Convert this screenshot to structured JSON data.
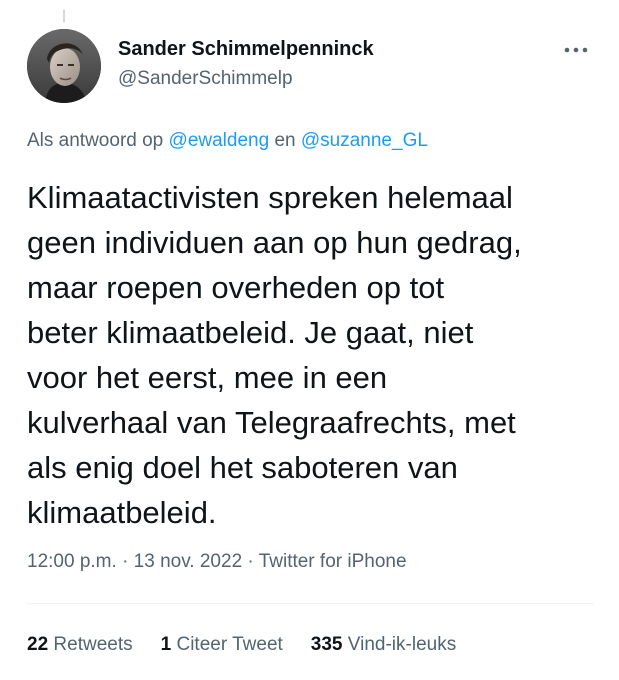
{
  "author": {
    "display_name": "Sander Schimmelpenninck",
    "handle": "@SanderSchimmelp"
  },
  "more_icon": "more-horizontal-icon",
  "reply_context": {
    "prefix": "Als antwoord op",
    "mention_1": "@ewaldeng",
    "joiner": "en",
    "mention_2": "@suzanne_GL"
  },
  "tweet": {
    "lines": [
      "Klimaatactivisten spreken helemaal",
      "geen individuen aan op hun gedrag,",
      "maar roepen overheden op tot",
      "beter klimaatbeleid. Je gaat, niet",
      "voor het eerst, mee in een",
      "kulverhaal van Telegraafrechts, met",
      "als enig doel het saboteren van",
      "klimaatbeleid."
    ]
  },
  "meta": {
    "time": "12:00 p.m.",
    "sep1": "·",
    "date": "13 nov. 2022",
    "sep2": "·",
    "source": "Twitter for iPhone"
  },
  "stats": {
    "retweets_count": "22",
    "retweets_label": "Retweets",
    "quotes_count": "1",
    "quotes_label": "Citeer Tweet",
    "likes_count": "335",
    "likes_label": "Vind-ik-leuks"
  },
  "colors": {
    "link": "#1d9bf0",
    "secondary_text": "#536471",
    "primary_text": "#0f1419"
  }
}
